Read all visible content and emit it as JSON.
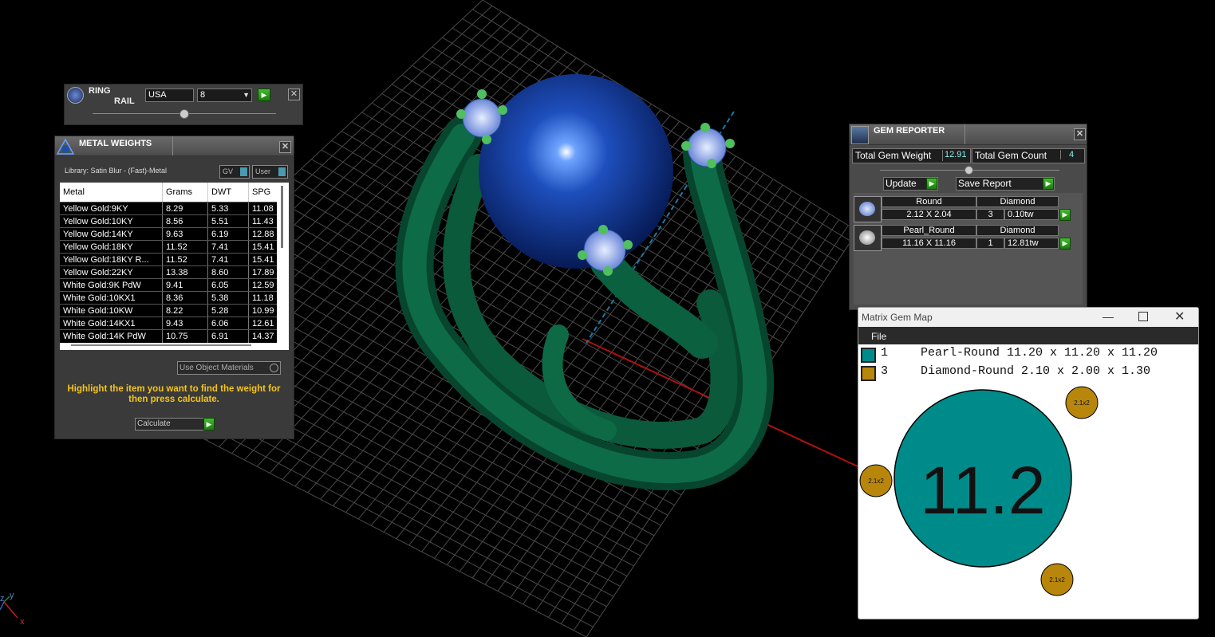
{
  "ring_rail": {
    "title_line1": "RING",
    "title_line2": "RAIL",
    "region": "USA",
    "size": "8"
  },
  "metal_weights": {
    "title": "METAL WEIGHTS",
    "library": "Library: Satin Blur - (Fast)-Metal",
    "gv_label": "GV",
    "user_label": "User",
    "columns": [
      "Metal",
      "Grams",
      "DWT",
      "SPG"
    ],
    "rows": [
      [
        "Yellow Gold:9KY",
        "8.29",
        "5.33",
        "11.08"
      ],
      [
        "Yellow Gold:10KY",
        "8.56",
        "5.51",
        "11.43"
      ],
      [
        "Yellow Gold:14KY",
        "9.63",
        "6.19",
        "12.88"
      ],
      [
        "Yellow Gold:18KY",
        "11.52",
        "7.41",
        "15.41"
      ],
      [
        "Yellow Gold:18KY R...",
        "11.52",
        "7.41",
        "15.41"
      ],
      [
        "Yellow Gold:22KY",
        "13.38",
        "8.60",
        "17.89"
      ],
      [
        "White Gold:9K PdW",
        "9.41",
        "6.05",
        "12.59"
      ],
      [
        "White Gold:10KX1",
        "8.36",
        "5.38",
        "11.18"
      ],
      [
        "White Gold:10KW",
        "8.22",
        "5.28",
        "10.99"
      ],
      [
        "White Gold:14KX1",
        "9.43",
        "6.06",
        "12.61"
      ],
      [
        "White Gold:14K PdW",
        "10.75",
        "6.91",
        "14.37"
      ]
    ],
    "use_object_materials": "Use Object Materials",
    "instruction": "Highlight the item you want to find the weight for then press calculate.",
    "calculate_label": "Calculate"
  },
  "gem_reporter": {
    "title": "GEM REPORTER",
    "total_weight_label": "Total Gem Weight",
    "total_weight_value": "12.91",
    "total_count_label": "Total Gem Count",
    "total_count_value": "4",
    "update_label": "Update",
    "save_report_label": "Save Report",
    "gems": [
      {
        "shape": "Round",
        "type": "Diamond",
        "size": "2.12 X 2.04",
        "count": "3",
        "weight": "0.10tw"
      },
      {
        "shape": "Pearl_Round",
        "type": "Diamond",
        "size": "11.16 X 11.16",
        "count": "1",
        "weight": "12.81tw"
      }
    ]
  },
  "gem_map": {
    "title": "Matrix Gem Map",
    "menu_file": "File",
    "legend": [
      {
        "count": "1",
        "label": "Pearl-Round 11.20 x 11.20 x 11.20",
        "color": "#008b8b"
      },
      {
        "count": "3",
        "label": "Diamond-Round 2.10 x 2.00 x 1.30",
        "color": "#b8860b"
      }
    ],
    "big_label": "11.2",
    "small_label": "2.1x2",
    "colors": {
      "pearl": "#008b8b",
      "diamond": "#b8860b"
    }
  },
  "viewport": {
    "axis_x": "x",
    "axis_y": "y",
    "axis_z": "z",
    "colors": {
      "ring": "#0e5a3c",
      "pearl": "#0d3a9a",
      "grid": "#555555"
    }
  }
}
